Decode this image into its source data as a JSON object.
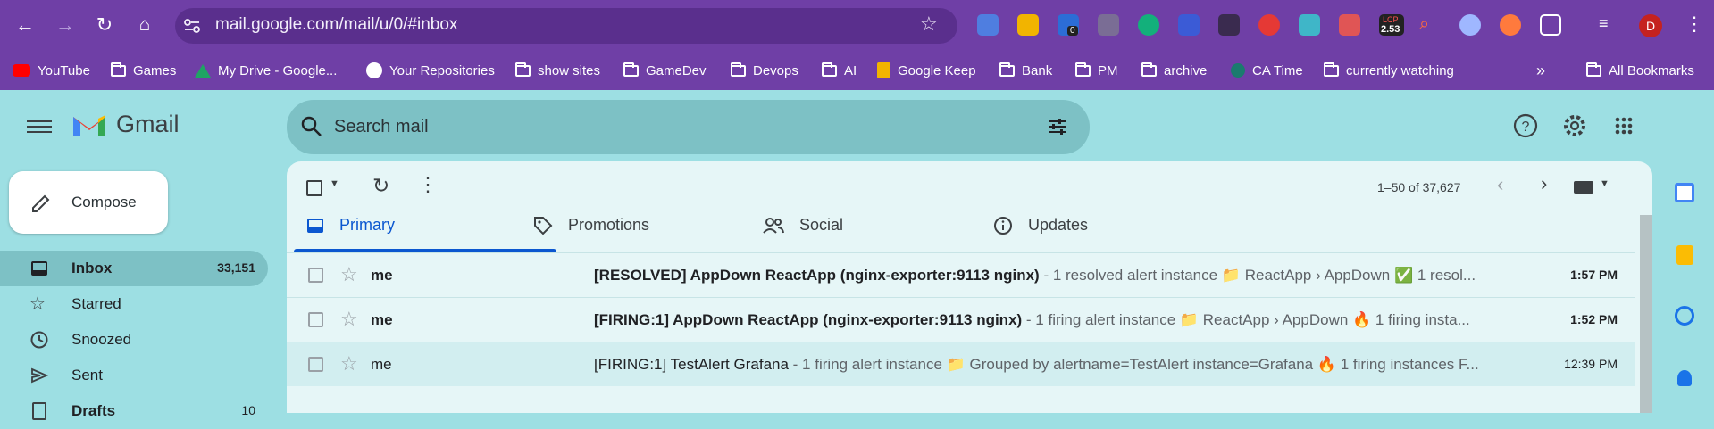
{
  "browser": {
    "url": "mail.google.com/mail/u/0/#inbox",
    "lcp_badge": "LCP",
    "lcp_value": "2.53",
    "ext_badge_count": "0",
    "profile_initial": "D",
    "bookmarks": [
      {
        "label": "YouTube",
        "icon": "youtube-icon"
      },
      {
        "label": "Games",
        "icon": "folder-icon"
      },
      {
        "label": "My Drive - Google...",
        "icon": "drive-icon"
      },
      {
        "label": "Your Repositories",
        "icon": "github-icon"
      },
      {
        "label": "show sites",
        "icon": "folder-icon"
      },
      {
        "label": "GameDev",
        "icon": "folder-icon"
      },
      {
        "label": "Devops",
        "icon": "folder-icon"
      },
      {
        "label": "AI",
        "icon": "folder-icon"
      },
      {
        "label": "Google Keep",
        "icon": "keep-icon"
      },
      {
        "label": "Bank",
        "icon": "folder-icon"
      },
      {
        "label": "PM",
        "icon": "folder-icon"
      },
      {
        "label": "archive",
        "icon": "folder-icon"
      },
      {
        "label": "CA Time",
        "icon": "clock-icon"
      },
      {
        "label": "currently watching",
        "icon": "folder-icon"
      }
    ],
    "more_bookmarks": "»",
    "all_bookmarks": "All Bookmarks"
  },
  "gmail": {
    "brand": "Gmail",
    "search_placeholder": "Search mail",
    "account_initial": "D",
    "compose_label": "Compose",
    "nav": [
      {
        "label": "Inbox",
        "count": "33,151",
        "icon": "inbox-icon",
        "active": true
      },
      {
        "label": "Starred",
        "count": "",
        "icon": "star-icon",
        "active": false
      },
      {
        "label": "Snoozed",
        "count": "",
        "icon": "clock-icon",
        "active": false
      },
      {
        "label": "Sent",
        "count": "",
        "icon": "send-icon",
        "active": false
      },
      {
        "label": "Drafts",
        "count": "10",
        "icon": "draft-icon",
        "active": false
      }
    ],
    "pagination": "1–50 of 37,627",
    "tabs": [
      {
        "label": "Primary",
        "icon": "inbox-icon",
        "active": true
      },
      {
        "label": "Promotions",
        "icon": "tag-icon",
        "active": false
      },
      {
        "label": "Social",
        "icon": "people-icon",
        "active": false
      },
      {
        "label": "Updates",
        "icon": "info-icon",
        "active": false
      }
    ],
    "emails": [
      {
        "sender": "me",
        "subject": "[RESOLVED] AppDown ReactApp (nginx-exporter:9113 nginx)",
        "snippet": " - 1 resolved alert instance 📁 ReactApp › AppDown ✅ 1 resol...",
        "time": "1:57 PM",
        "unread": true
      },
      {
        "sender": "me",
        "subject": "[FIRING:1] AppDown ReactApp (nginx-exporter:9113 nginx)",
        "snippet": " - 1 firing alert instance 📁 ReactApp › AppDown 🔥 1 firing insta...",
        "time": "1:52 PM",
        "unread": true
      },
      {
        "sender": "me",
        "subject": "[FIRING:1] TestAlert Grafana",
        "snippet": " - 1 firing alert instance 📁 Grouped by alertname=TestAlert instance=Grafana 🔥 1 firing instances F...",
        "time": "12:39 PM",
        "unread": false
      }
    ]
  },
  "colors": {
    "chrome": "#6f3fa6",
    "gmail_bg": "#9ddfe3",
    "accent": "#0b57d0"
  }
}
